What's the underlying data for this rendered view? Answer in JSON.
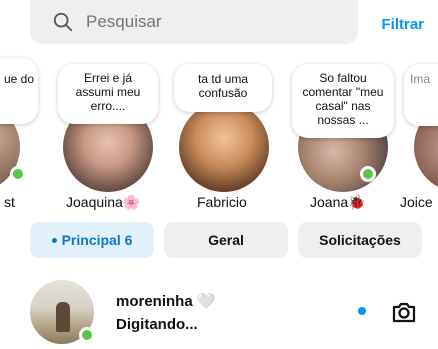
{
  "search": {
    "placeholder": "Pesquisar"
  },
  "filter_label": "Filtrar",
  "stories": [
    {
      "name": "",
      "note": "ue do",
      "online": true
    },
    {
      "name": "Joaquina🌸",
      "note": "Errei e já assumi meu erro....",
      "online": false
    },
    {
      "name": "Fabricio",
      "note": "ta td uma confusão",
      "online": false
    },
    {
      "name": "Joana🐞",
      "note": "So faltou comentar \"meu casal\" nas nossas ...",
      "online": true
    },
    {
      "name": "Joice",
      "note": "Ima",
      "online": false
    }
  ],
  "partial_left_name": "st",
  "tabs": [
    {
      "label": "Principal 6",
      "active": true
    },
    {
      "label": "Geral",
      "active": false
    },
    {
      "label": "Solicitações",
      "active": false
    }
  ],
  "thread": {
    "name": "moreninha 🤍",
    "status": "Digitando...",
    "unread": true
  },
  "colors": {
    "accent": "#0095f6",
    "online": "#5ac54b",
    "tab_active_bg": "#e3f1fd"
  },
  "icons": [
    "search-icon",
    "camera-icon",
    "online-indicator"
  ]
}
